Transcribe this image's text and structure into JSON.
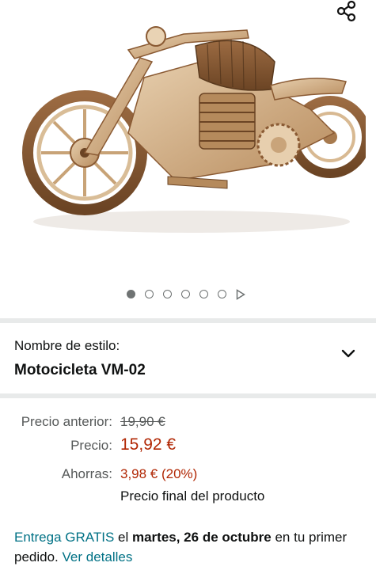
{
  "gallery": {
    "image_alt": "Motocicleta de madera VM-02",
    "share_icon": "share-icon",
    "dots_count": 6,
    "active_dot_index": 0,
    "next_icon": "play-triangle-icon"
  },
  "style_selector": {
    "label": "Nombre de estilo:",
    "value": "Motocicleta VM-02",
    "icon": "chevron-down-icon"
  },
  "price": {
    "previous_label": "Precio anterior:",
    "previous_value": "19,90 €",
    "current_label": "Precio:",
    "current_value": "15,92 €",
    "savings_label": "Ahorras:",
    "savings_value": "3,98 € (20%)",
    "final_note": "Precio final del producto"
  },
  "delivery": {
    "free_label": "Entrega GRATIS",
    "connector": " el ",
    "date": "martes, 26 de octubre",
    "suffix": " en tu primer pedido. ",
    "details_link": "Ver detalles"
  },
  "colors": {
    "price_red": "#b12704",
    "link_teal": "#007185",
    "divider": "#e8eaea"
  }
}
